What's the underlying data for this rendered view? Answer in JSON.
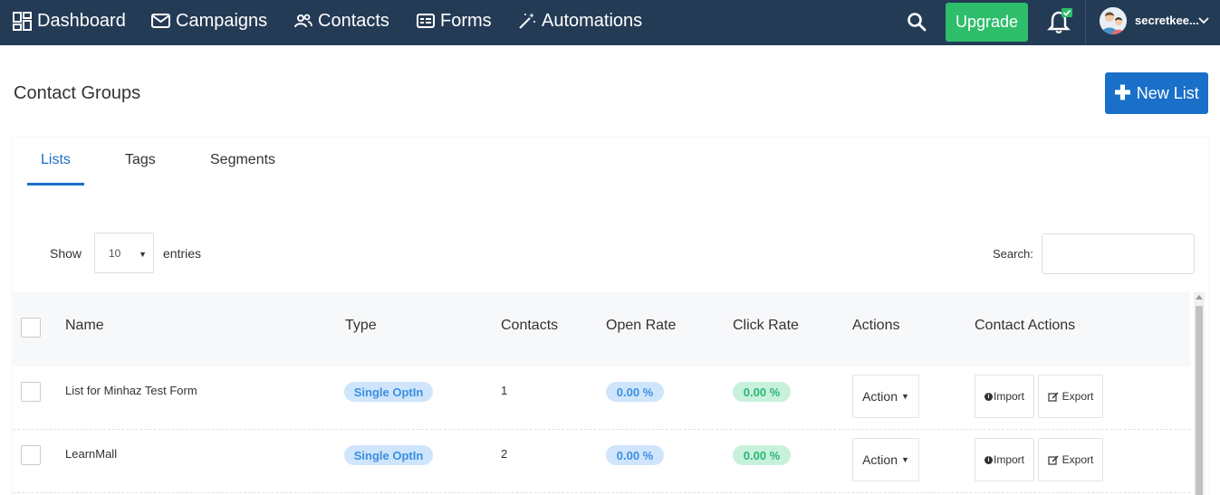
{
  "nav": {
    "items": [
      {
        "label": "Dashboard",
        "icon": "dashboard-icon"
      },
      {
        "label": "Campaigns",
        "icon": "mail-icon"
      },
      {
        "label": "Contacts",
        "icon": "users-icon"
      },
      {
        "label": "Forms",
        "icon": "form-icon"
      },
      {
        "label": "Automations",
        "icon": "magic-wand-icon"
      }
    ],
    "upgrade_label": "Upgrade",
    "username": "secretkee...",
    "bar_color": "#243b55",
    "upgrade_color": "#2ebd6b"
  },
  "page": {
    "title": "Contact Groups",
    "new_list_label": "New List",
    "accent_color": "#1a6fc9"
  },
  "tabs": [
    {
      "label": "Lists",
      "active": true
    },
    {
      "label": "Tags",
      "active": false
    },
    {
      "label": "Segments",
      "active": false
    }
  ],
  "table_controls": {
    "show_label": "Show",
    "entries_value": "10",
    "entries_label": "entries",
    "search_label": "Search:"
  },
  "table": {
    "headers": [
      "Name",
      "Type",
      "Contacts",
      "Open Rate",
      "Click Rate",
      "Actions",
      "Contact Actions"
    ],
    "rows": [
      {
        "name": "List for Minhaz Test Form",
        "type": "Single OptIn",
        "contacts": "1",
        "open_rate": "0.00 %",
        "click_rate": "0.00 %",
        "action_label": "Action",
        "import_label": "Import",
        "export_label": "Export"
      },
      {
        "name": "LearnMall",
        "type": "Single OptIn",
        "contacts": "2",
        "open_rate": "0.00 %",
        "click_rate": "0.00 %",
        "action_label": "Action",
        "import_label": "Import",
        "export_label": "Export"
      }
    ]
  }
}
